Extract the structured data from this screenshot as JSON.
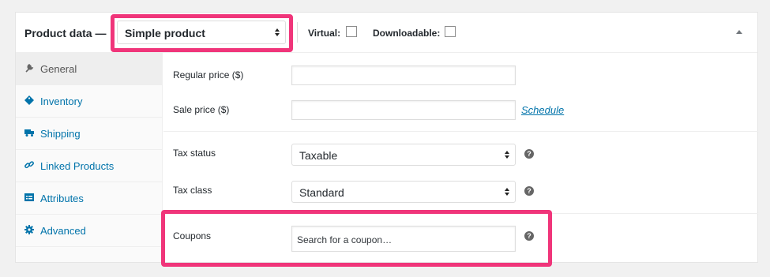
{
  "header": {
    "title": "Product data —",
    "product_type": "Simple product",
    "virtual_label": "Virtual:",
    "downloadable_label": "Downloadable:"
  },
  "tabs": [
    {
      "label": "General",
      "icon": "wrench-icon",
      "active": true
    },
    {
      "label": "Inventory",
      "icon": "tag-icon",
      "active": false
    },
    {
      "label": "Shipping",
      "icon": "truck-icon",
      "active": false
    },
    {
      "label": "Linked Products",
      "icon": "link-icon",
      "active": false
    },
    {
      "label": "Attributes",
      "icon": "list-icon",
      "active": false
    },
    {
      "label": "Advanced",
      "icon": "gear-icon",
      "active": false
    }
  ],
  "fields": {
    "regular_price_label": "Regular price ($)",
    "sale_price_label": "Sale price ($)",
    "schedule_link": "Schedule",
    "tax_status_label": "Tax status",
    "tax_status_value": "Taxable",
    "tax_class_label": "Tax class",
    "tax_class_value": "Standard",
    "coupons_label": "Coupons",
    "coupons_placeholder": "Search for a coupon…",
    "help_glyph": "?"
  },
  "colors": {
    "highlight": "#f0357a",
    "link": "#0073aa",
    "active_tab_bg": "#eeeeee"
  }
}
